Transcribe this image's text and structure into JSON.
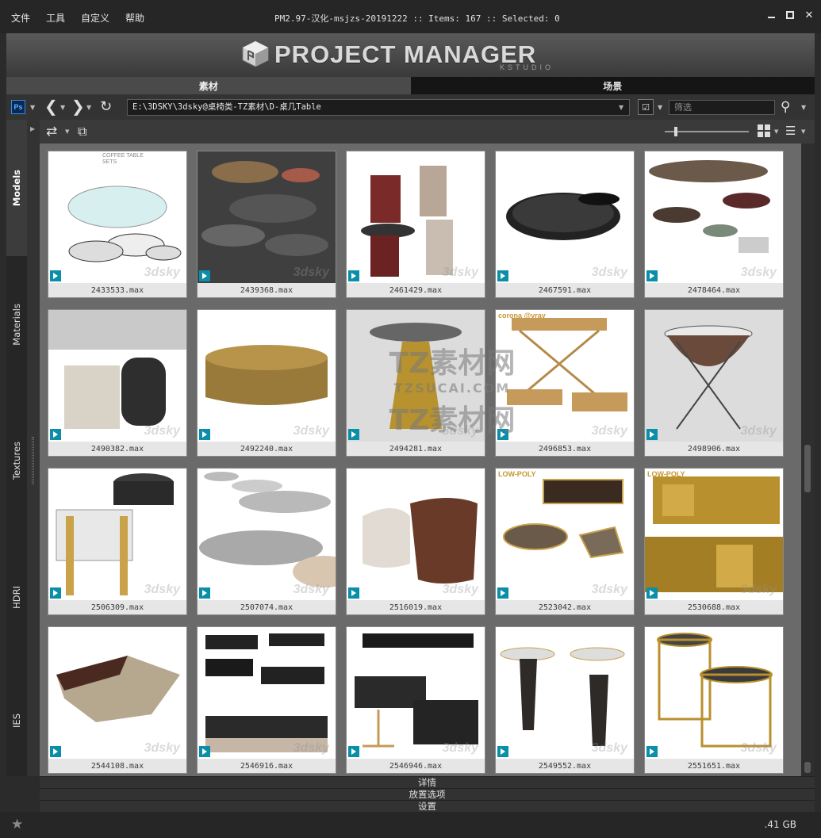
{
  "menu": [
    "文件",
    "工具",
    "自定义",
    "帮助"
  ],
  "window_title": "PM2.97-汉化-msjzs-20191222  :: Items: 167  :: Selected: 0",
  "banner": {
    "logo_text": "PROJECT MANAGER",
    "logo_sub": "KSTUDIO"
  },
  "tabs": [
    {
      "label": "素材",
      "active": true
    },
    {
      "label": "场景",
      "active": false
    }
  ],
  "toolbar": {
    "ps_label": "Ps",
    "path": "E:\\3DSKY\\3dsky@桌椅类-TZ素材\\D-桌几Table",
    "filter_placeholder": "筛选"
  },
  "left_tabs": [
    {
      "label": "Models",
      "active": true
    },
    {
      "label": "Materials",
      "active": false
    },
    {
      "label": "Textures",
      "active": false
    },
    {
      "label": "HDRI",
      "active": false
    },
    {
      "label": "IES",
      "active": false
    }
  ],
  "items": [
    {
      "name": "2433533.max",
      "header": "COFFEE TABLE SETS"
    },
    {
      "name": "2439368.max"
    },
    {
      "name": "2461429.max"
    },
    {
      "name": "2467591.max"
    },
    {
      "name": "2478464.max"
    },
    {
      "name": "2490382.max"
    },
    {
      "name": "2492240.max"
    },
    {
      "name": "2494281.max"
    },
    {
      "name": "2496853.max",
      "tag": "corona @vray"
    },
    {
      "name": "2498906.max"
    },
    {
      "name": "2506309.max"
    },
    {
      "name": "2507074.max"
    },
    {
      "name": "2516019.max"
    },
    {
      "name": "2523042.max",
      "tag": "LOW-POLY"
    },
    {
      "name": "2530688.max",
      "tag": "LOW-POLY"
    },
    {
      "name": "2544108.max"
    },
    {
      "name": "2546916.max"
    },
    {
      "name": "2546946.max"
    },
    {
      "name": "2549552.max"
    },
    {
      "name": "2551651.max"
    }
  ],
  "thumb_watermark": "3dsky",
  "overlay_watermark": {
    "line1": "TZ素材网",
    "line2": "TZSUCAI.COM",
    "line3": "TZ素材网"
  },
  "rollouts": [
    "详情",
    "放置选项",
    "设置"
  ],
  "status": {
    "disk": ".41 GB"
  },
  "colors": {
    "max_badge": "#0b8ea8",
    "banner_text": "#d9d9d9",
    "ps_blue": "#3a8de0"
  }
}
